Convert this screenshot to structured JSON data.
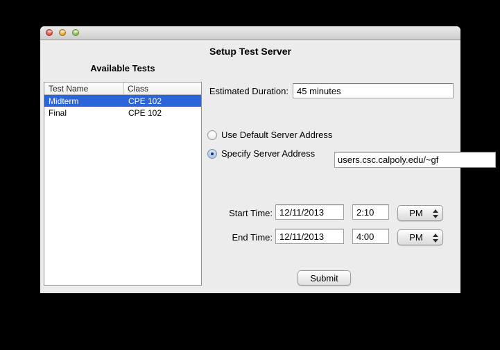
{
  "window": {
    "heading": "Setup Test Server",
    "traffic_lights": {
      "close": "close-button",
      "minimize": "minimize-button",
      "zoom": "zoom-button"
    }
  },
  "tests_panel": {
    "label": "Available Tests",
    "table": {
      "columns": {
        "name": "Test Name",
        "class": "Class"
      },
      "rows": [
        {
          "test_name": "Midterm",
          "class": "CPE 102",
          "selected": true
        },
        {
          "test_name": "Final",
          "class": "CPE 102",
          "selected": false
        }
      ]
    }
  },
  "form": {
    "estimated_duration": {
      "label": "Estimated Duration:",
      "value": "45 minutes"
    },
    "server_address": {
      "default_option_label": "Use Default Server Address",
      "specify_option_label": "Specify Server Address",
      "selected_option": "specify",
      "address_value": "users.csc.calpoly.edu/~gf"
    },
    "start_time": {
      "label": "Start Time:",
      "date": "12/11/2013",
      "time": "2:10",
      "meridiem": "PM"
    },
    "end_time": {
      "label": "End Time:",
      "date": "12/11/2013",
      "time": "4:00",
      "meridiem": "PM"
    },
    "submit_label": "Submit"
  },
  "colors": {
    "selection_blue": "#2b65d9",
    "window_background": "#ececec",
    "canvas_background": "#000000"
  }
}
